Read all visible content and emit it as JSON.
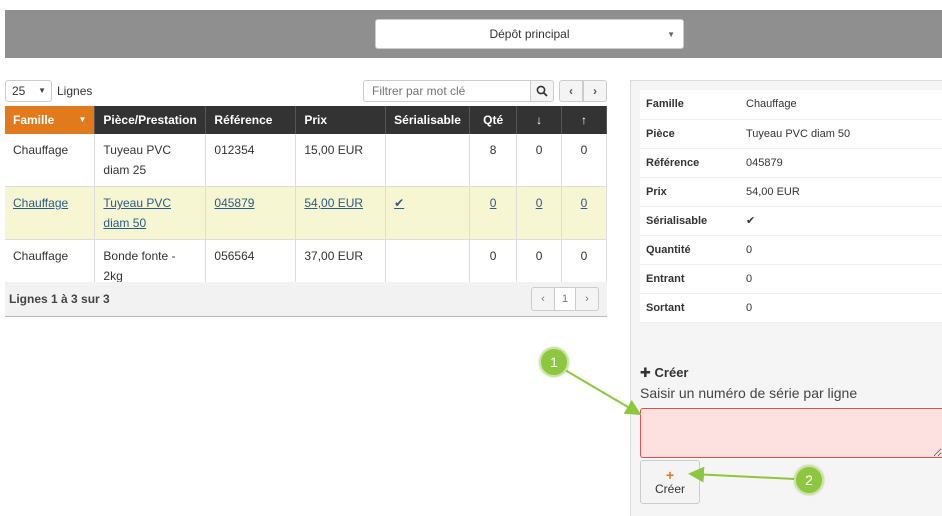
{
  "header": {
    "depot_select": "Dépôt principal"
  },
  "toolbar": {
    "page_size": "25",
    "page_size_label": "Lignes",
    "filter_placeholder": "Filtrer par mot clé"
  },
  "grid": {
    "columns": [
      "Famille",
      "Pièce/Prestation",
      "Référence",
      "Prix",
      "Sérialisable",
      "Qté",
      "↓",
      "↑"
    ],
    "rows": [
      {
        "famille": "Chauffage",
        "piece_line1": "Tuyeau PVC",
        "piece_line2": "diam 25",
        "reference": "012354",
        "prix": "15,00 EUR",
        "serialisable": "",
        "qte": "8",
        "entrant": "0",
        "sortant": "0"
      },
      {
        "famille": "Chauffage",
        "piece_line1": "Tuyeau PVC",
        "piece_line2": "diam 50",
        "reference": "045879",
        "prix": "54,00 EUR",
        "serialisable": "✔",
        "qte": "0",
        "entrant": "0",
        "sortant": "0"
      },
      {
        "famille": "Chauffage",
        "piece_line1": "Bonde fonte -",
        "piece_line2": "2kg",
        "reference": "056564",
        "prix": "37,00 EUR",
        "serialisable": "",
        "qte": "0",
        "entrant": "0",
        "sortant": "0"
      }
    ],
    "footer_info": "Lignes 1 à 3 sur 3",
    "current_page": "1"
  },
  "detail": {
    "rows": [
      {
        "label": "Famille",
        "value": "Chauffage"
      },
      {
        "label": "Pièce",
        "value": "Tuyeau PVC diam 50"
      },
      {
        "label": "Référence",
        "value": "045879"
      },
      {
        "label": "Prix",
        "value": "54,00 EUR"
      },
      {
        "label": "Sérialisable",
        "value": "✔"
      },
      {
        "label": "Quantité",
        "value": "0"
      },
      {
        "label": "Entrant",
        "value": "0"
      },
      {
        "label": "Sortant",
        "value": "0"
      }
    ]
  },
  "create": {
    "title": "Créer",
    "hint": "Saisir un numéro de série par ligne",
    "button_label": "Créer",
    "serial_value": ""
  },
  "callouts": [
    "1",
    "2"
  ],
  "colors": {
    "accent": "#e07a1d",
    "header_dark": "#333333",
    "selected_row": "#f6f7d2",
    "error_input": "#fde1e1",
    "callout": "#8dc63f"
  }
}
